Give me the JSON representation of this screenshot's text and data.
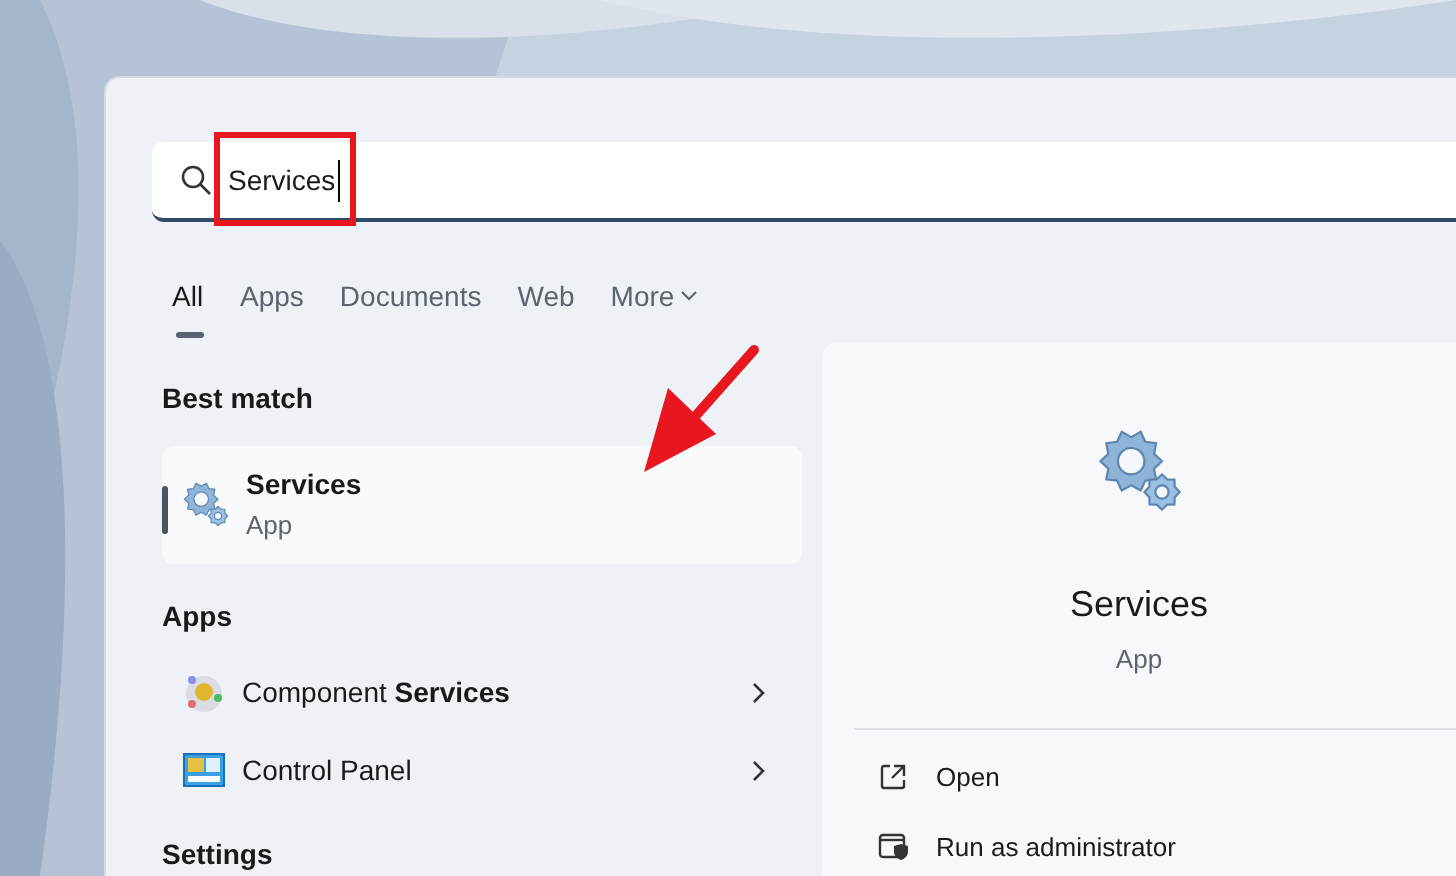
{
  "search": {
    "value": "Services"
  },
  "tabs": [
    {
      "label": "All",
      "selected": true
    },
    {
      "label": "Apps",
      "selected": false
    },
    {
      "label": "Documents",
      "selected": false
    },
    {
      "label": "Web",
      "selected": false
    },
    {
      "label": "More",
      "selected": false,
      "dropdown": true
    }
  ],
  "best_match": {
    "heading": "Best match",
    "title": "Services",
    "subtitle": "App",
    "selected": true
  },
  "apps": {
    "heading": "Apps",
    "items": [
      {
        "label": "Component **Services**",
        "kind": "component"
      },
      {
        "label": "Control Panel",
        "kind": "control"
      }
    ]
  },
  "settings": {
    "heading": "Settings"
  },
  "detail": {
    "title": "Services",
    "subtitle": "App",
    "actions": [
      {
        "label": "Open",
        "kind": "open"
      },
      {
        "label": "Run as administrator",
        "kind": "admin"
      }
    ]
  }
}
